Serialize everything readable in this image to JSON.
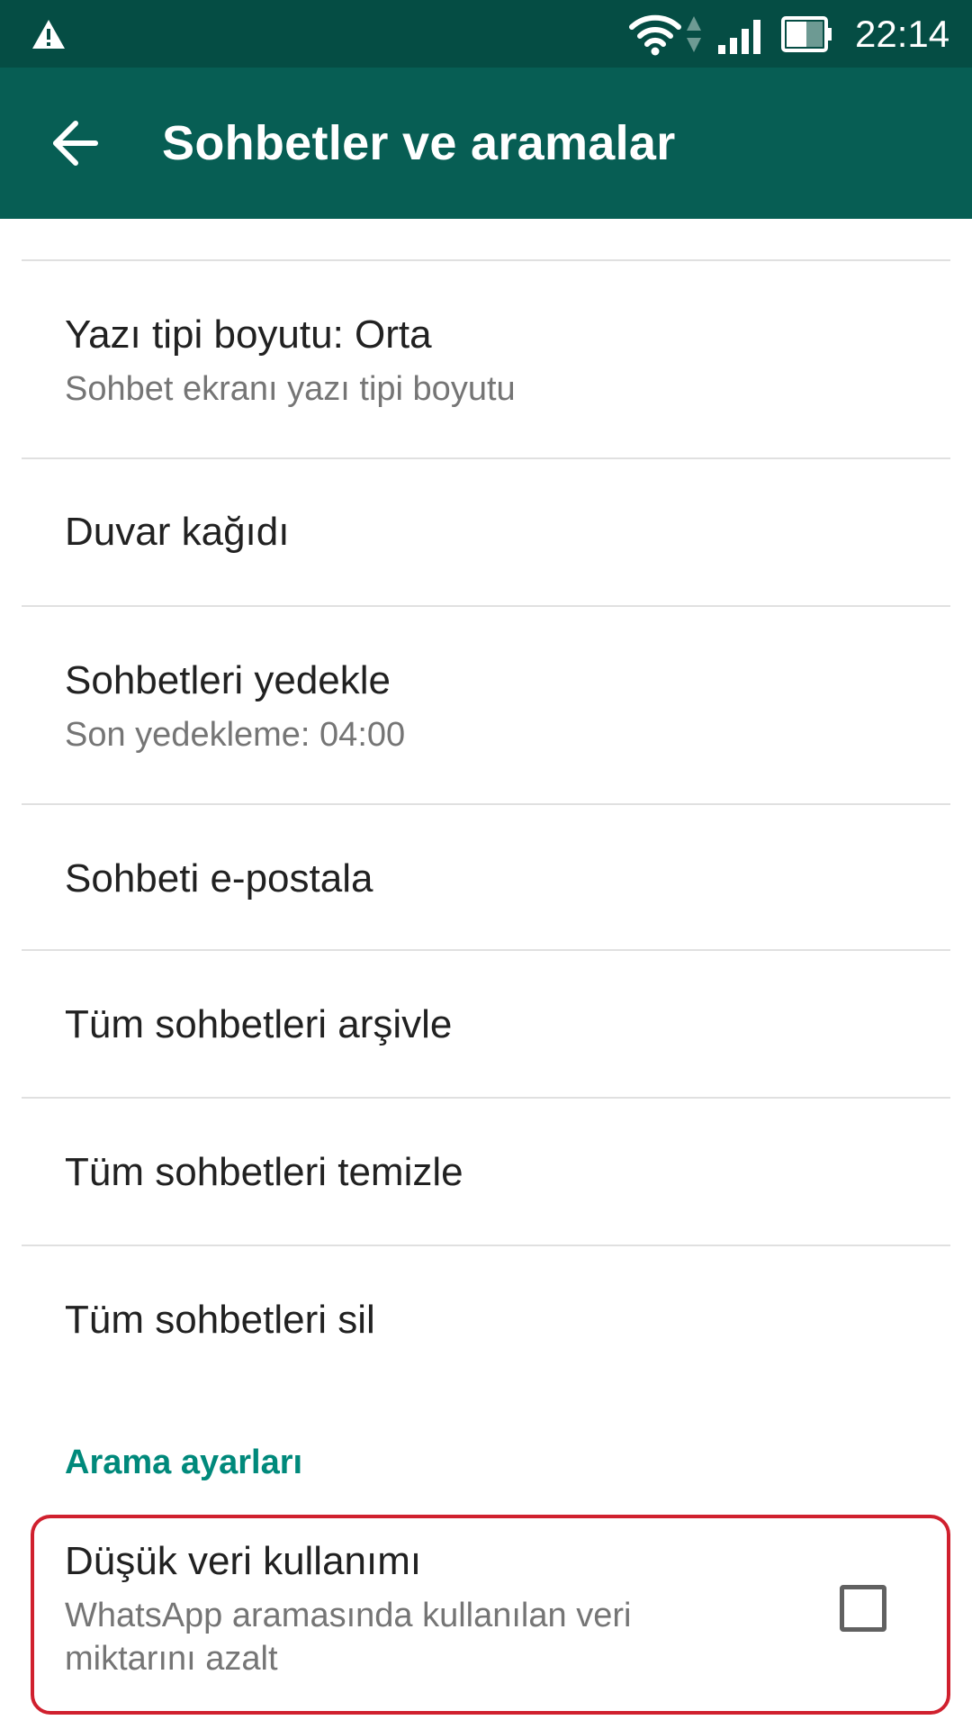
{
  "status_bar": {
    "time": "22:14",
    "icons": [
      "warning-icon",
      "wifi-icon",
      "data-updown-icon",
      "signal-icon",
      "battery-icon"
    ]
  },
  "app_bar": {
    "title": "Sohbetler ve aramalar",
    "back_icon": "arrow-left-icon"
  },
  "settings": {
    "font_size": {
      "title": "Yazı tipi boyutu: Orta",
      "subtitle": "Sohbet ekranı yazı tipi boyutu"
    },
    "wallpaper": {
      "title": "Duvar kağıdı"
    },
    "backup": {
      "title": "Sohbetleri yedekle",
      "subtitle": "Son yedekleme: 04:00"
    },
    "email_chat": {
      "title": "Sohbeti e-postala"
    },
    "archive_all": {
      "title": "Tüm sohbetleri arşivle"
    },
    "clear_all": {
      "title": "Tüm sohbetleri temizle"
    },
    "delete_all": {
      "title": "Tüm sohbetleri sil"
    }
  },
  "call_settings": {
    "header": "Arama ayarları",
    "low_data": {
      "title": "Düşük veri kullanımı",
      "subtitle_line1": "WhatsApp aramasında kullanılan veri",
      "subtitle_line2": "miktarını azalt",
      "checked": false
    }
  },
  "colors": {
    "status_bar": "#054d44",
    "app_bar": "#075e54",
    "accent": "#00897b",
    "highlight": "#d0202e"
  }
}
